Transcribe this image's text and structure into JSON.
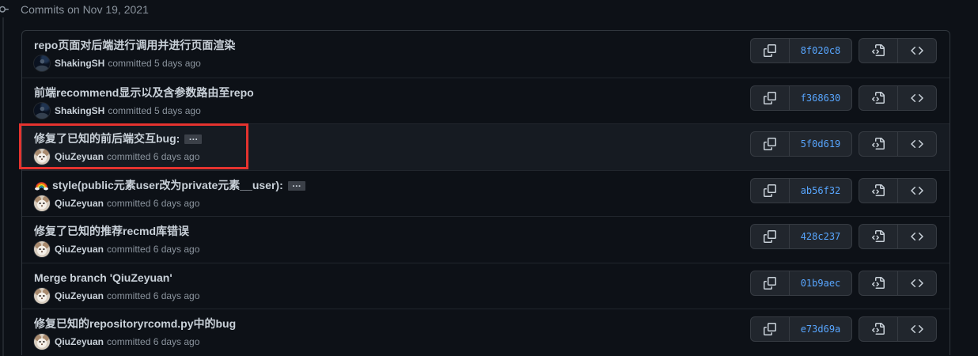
{
  "header": {
    "title": "Commits on Nov 19, 2021",
    "icon": "git-commit-icon"
  },
  "ellipsis": "…",
  "icons": {
    "copy": "copy-icon",
    "browse_files": "file-code-icon",
    "browse_code": "code-icon",
    "emoji": "rainbow-emoji-icon"
  },
  "commits": [
    {
      "message": "repo页面对后端进行调用并进行页面渲染",
      "author": "ShakingSH",
      "committed": "committed 5 days ago",
      "sha": "8f020c8",
      "avatar": "shakingsh-avatar",
      "expandable": false
    },
    {
      "message": "前端recommend显示以及含参数路由至repo",
      "author": "ShakingSH",
      "committed": "committed 5 days ago",
      "sha": "f368630",
      "avatar": "shakingsh-avatar",
      "expandable": false
    },
    {
      "message": "修复了已知的前后端交互bug:",
      "author": "QiuZeyuan",
      "committed": "committed 6 days ago",
      "sha": "5f0d619",
      "avatar": "qiuzeyuan-avatar",
      "expandable": true,
      "state": "hover",
      "highlighted": true
    },
    {
      "message": "style(public元素user改为private元素__user):",
      "emoji": "rainbow-emoji-icon",
      "author": "QiuZeyuan",
      "committed": "committed 6 days ago",
      "sha": "ab56f32",
      "avatar": "qiuzeyuan-avatar",
      "expandable": true
    },
    {
      "message": "修复了已知的推荐recmd库错误",
      "author": "QiuZeyuan",
      "committed": "committed 6 days ago",
      "sha": "428c237",
      "avatar": "qiuzeyuan-avatar",
      "expandable": false
    },
    {
      "message": "Merge branch 'QiuZeyuan'",
      "author": "QiuZeyuan",
      "committed": "committed 6 days ago",
      "sha": "01b9aec",
      "avatar": "qiuzeyuan-avatar",
      "expandable": false
    },
    {
      "message": "修复已知的repositoryrcomd.py中的bug",
      "author": "QiuZeyuan",
      "committed": "committed 6 days ago",
      "sha": "e73d69a",
      "avatar": "qiuzeyuan-avatar",
      "expandable": false
    }
  ],
  "colors": {
    "background": "#0d1117",
    "border": "#30363d",
    "text": "#c9d1d9",
    "muted": "#8b949e",
    "link": "#58a6ff",
    "button": "#21262d",
    "row_hover": "#161b22",
    "highlight": "#e5332f"
  }
}
